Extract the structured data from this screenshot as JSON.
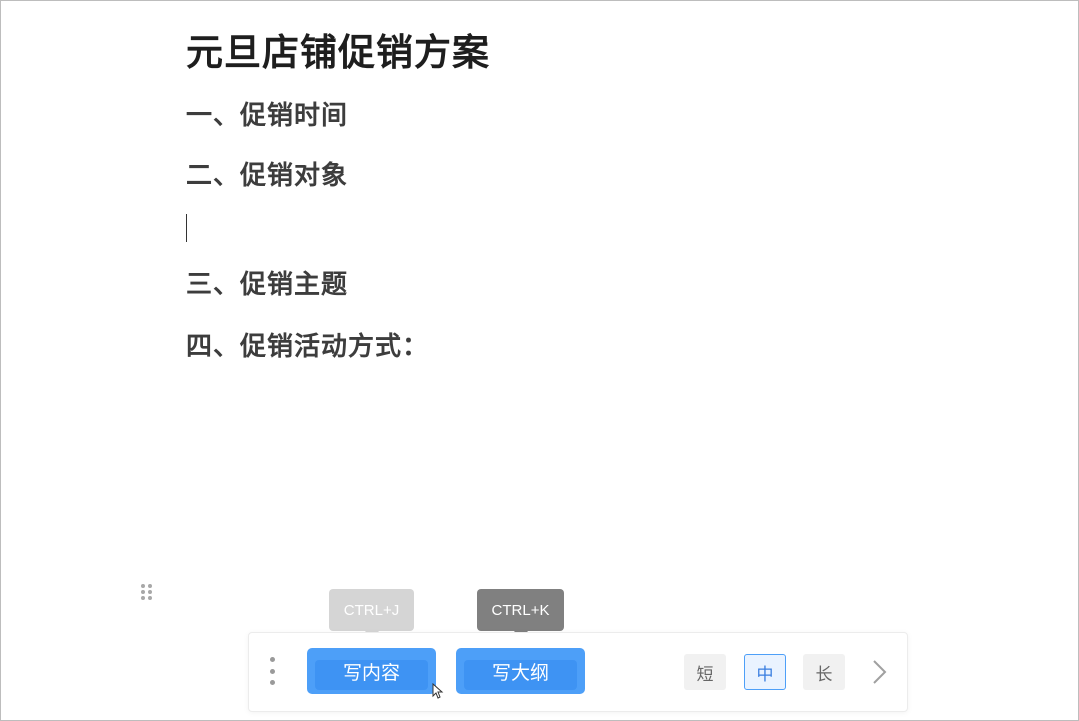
{
  "document": {
    "title": "元旦店铺促销方案",
    "headings": [
      "一、促销时间",
      "二、促销对象",
      "三、促销主题",
      "四、促销活动方式："
    ]
  },
  "tooltips": {
    "write_content_shortcut": "CTRL+J",
    "write_outline_shortcut": "CTRL+K"
  },
  "ai_bar": {
    "write_content_label": "写内容",
    "write_outline_label": "写大纲",
    "length_options": [
      "短",
      "中",
      "长"
    ],
    "selected_length": "中",
    "accent_color": "#4d9ff8",
    "menu_icon": "vertical-dots-icon",
    "next_icon": "chevron-right-icon",
    "drag_icon": "drag-handle-icon"
  }
}
